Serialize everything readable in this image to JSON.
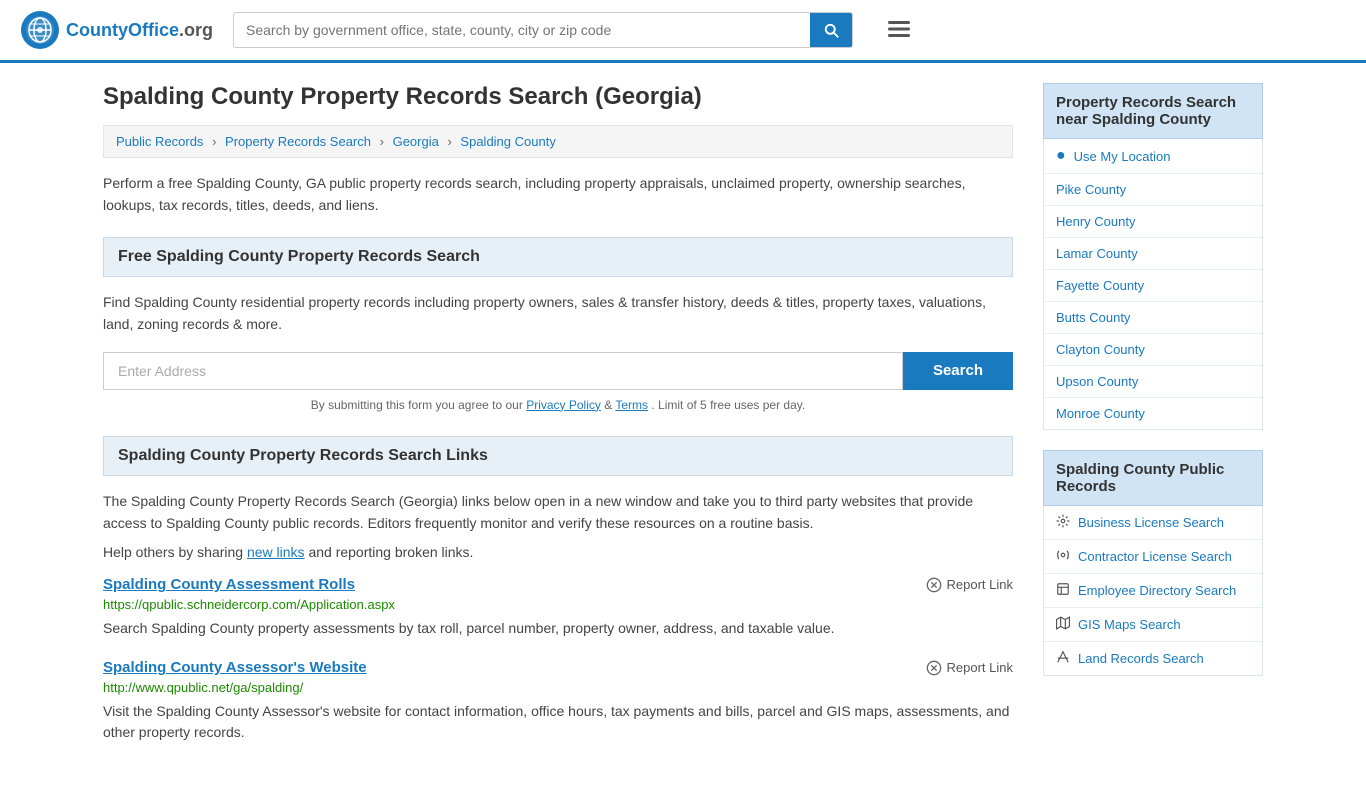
{
  "header": {
    "logo_text": "CountyOffice",
    "logo_suffix": ".org",
    "search_placeholder": "Search by government office, state, county, city or zip code"
  },
  "page": {
    "title": "Spalding County Property Records Search (Georgia)",
    "breadcrumbs": [
      {
        "label": "Public Records",
        "href": "#"
      },
      {
        "label": "Property Records Search",
        "href": "#"
      },
      {
        "label": "Georgia",
        "href": "#"
      },
      {
        "label": "Spalding County",
        "href": "#"
      }
    ],
    "intro": "Perform a free Spalding County, GA public property records search, including property appraisals, unclaimed property, ownership searches, lookups, tax records, titles, deeds, and liens.",
    "free_search_title": "Free Spalding County Property Records Search",
    "free_search_desc": "Find Spalding County residential property records including property owners, sales & transfer history, deeds & titles, property taxes, valuations, land, zoning records & more.",
    "address_placeholder": "Enter Address",
    "search_button_label": "Search",
    "form_disclaimer": "By submitting this form you agree to our",
    "privacy_policy_label": "Privacy Policy",
    "terms_label": "Terms",
    "form_disclaimer_end": ". Limit of 5 free uses per day.",
    "links_section_title": "Spalding County Property Records Search Links",
    "links_desc": "The Spalding County Property Records Search (Georgia) links below open in a new window and take you to third party websites that provide access to Spalding County public records. Editors frequently monitor and verify these resources on a routine basis.",
    "share_text": "Help others by sharing",
    "new_links_label": "new links",
    "share_text2": "and reporting broken links.",
    "report_link_label": "Report Link",
    "link_cards": [
      {
        "title": "Spalding County Assessment Rolls",
        "url": "https://qpublic.schneidercorp.com/Application.aspx",
        "desc": "Search Spalding County property assessments by tax roll, parcel number, property owner, address, and taxable value."
      },
      {
        "title": "Spalding County Assessor's Website",
        "url": "http://www.qpublic.net/ga/spalding/",
        "desc": "Visit the Spalding County Assessor's website for contact information, office hours, tax payments and bills, parcel and GIS maps, assessments, and other property records."
      }
    ]
  },
  "sidebar": {
    "nearby_title": "Property Records Search near Spalding County",
    "use_location_label": "Use My Location",
    "nearby_counties": [
      {
        "label": "Pike County"
      },
      {
        "label": "Henry County"
      },
      {
        "label": "Lamar County"
      },
      {
        "label": "Fayette County"
      },
      {
        "label": "Butts County"
      },
      {
        "label": "Clayton County"
      },
      {
        "label": "Upson County"
      },
      {
        "label": "Monroe County"
      }
    ],
    "public_records_title": "Spalding County Public Records",
    "public_records_links": [
      {
        "icon": "⚙⚙",
        "label": "Business License Search"
      },
      {
        "icon": "⚙",
        "label": "Contractor License Search"
      },
      {
        "icon": "▬",
        "label": "Employee Directory Search"
      },
      {
        "icon": "▦",
        "label": "GIS Maps Search"
      },
      {
        "icon": "▲",
        "label": "Land Records Search"
      }
    ]
  }
}
